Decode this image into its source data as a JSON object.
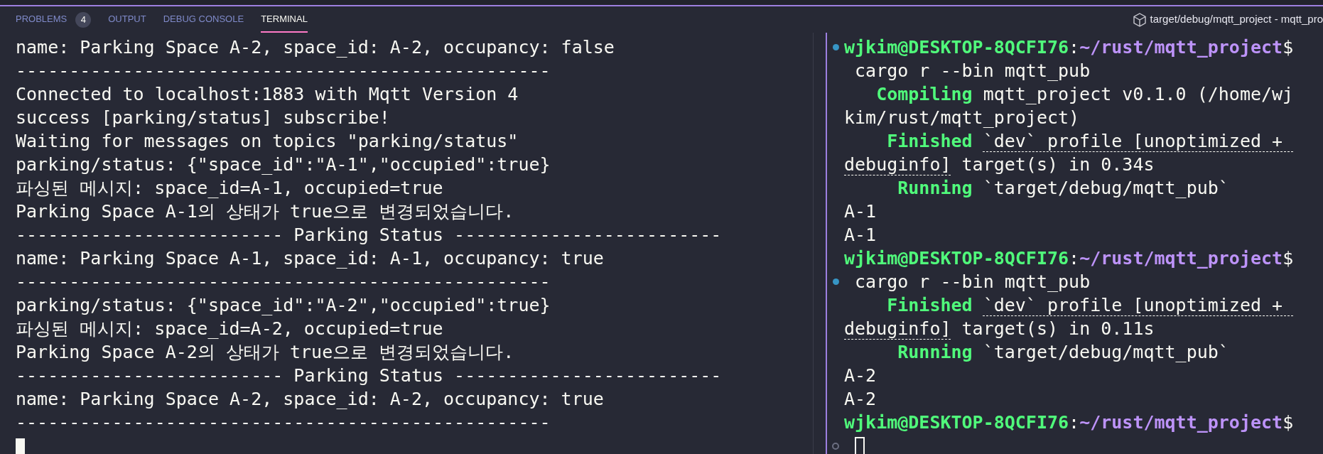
{
  "panel_tabs": [
    {
      "label": "PROBLEMS",
      "badge": "4",
      "selected": false
    },
    {
      "label": "OUTPUT",
      "selected": false
    },
    {
      "label": "DEBUG CONSOLE",
      "selected": false
    },
    {
      "label": "TERMINAL",
      "selected": true
    }
  ],
  "terminal_title": "target/debug/mqtt_project - mqtt_pro",
  "left_terminal": {
    "lines": [
      "name: Parking Space A-2, space_id: A-2, occupancy: false",
      "--------------------------------------------------",
      "Connected to localhost:1883 with Mqtt Version 4",
      "success [parking/status] subscribe!",
      "Waiting for messages on topics \"parking/status\"",
      "parking/status: {\"space_id\":\"A-1\",\"occupied\":true}",
      "파싱된 메시지: space_id=A-1, occupied=true",
      "Parking Space A-1의 상태가 true으로 변경되었습니다.",
      "------------------------- Parking Status -------------------------",
      "name: Parking Space A-1, space_id: A-1, occupancy: true",
      "--------------------------------------------------",
      "parking/status: {\"space_id\":\"A-2\",\"occupied\":true}",
      "파싱된 메시지: space_id=A-2, occupied=true",
      "Parking Space A-2의 상태가 true으로 변경되었습니다.",
      "------------------------- Parking Status -------------------------",
      "name: Parking Space A-2, space_id: A-2, occupancy: true",
      "--------------------------------------------------"
    ],
    "cursor": true
  },
  "right_terminal": {
    "lines": [
      {
        "command_mark": {
          "finished": true
        },
        "segments": [
          {
            "kind": "user",
            "text": "wjkim@DESKTOP-8QCFI76"
          },
          {
            "kind": "plain",
            "text": ":"
          },
          {
            "kind": "path",
            "text": "~/rust/mqtt_project"
          },
          {
            "kind": "plain",
            "text": "$"
          }
        ]
      },
      {
        "segments": [
          {
            "kind": "plain",
            "text": " cargo r --bin mqtt_pub"
          }
        ]
      },
      {
        "segments": [
          {
            "kind": "status",
            "text": "Compiling"
          },
          {
            "kind": "plain",
            "text": "mqtt_project v0.1.0 (/home/wj"
          }
        ]
      },
      {
        "segments": [
          {
            "kind": "plain",
            "text": "kim/rust/mqtt_project)"
          }
        ]
      },
      {
        "segments": [
          {
            "kind": "status",
            "text": "Finished"
          },
          {
            "kind": "link",
            "text": "`dev` profile [unoptimized + "
          }
        ]
      },
      {
        "segments": [
          {
            "kind": "link",
            "text": "debuginfo]"
          },
          {
            "kind": "plain",
            "text": " target(s) in 0.34s"
          }
        ]
      },
      {
        "segments": [
          {
            "kind": "status",
            "text": "Running"
          },
          {
            "kind": "plain",
            "text": "`target/debug/mqtt_pub`"
          }
        ]
      },
      {
        "segments": [
          {
            "kind": "plain",
            "text": "A-1"
          }
        ]
      },
      {
        "segments": [
          {
            "kind": "plain",
            "text": "A-1"
          }
        ]
      },
      {
        "segments": [
          {
            "kind": "user",
            "text": "wjkim@DESKTOP-8QCFI76"
          },
          {
            "kind": "plain",
            "text": ":"
          },
          {
            "kind": "path",
            "text": "~/rust/mqtt_project"
          },
          {
            "kind": "plain",
            "text": "$"
          }
        ]
      },
      {
        "command_mark": {
          "finished": true
        },
        "segments": [
          {
            "kind": "plain",
            "text": " cargo r --bin mqtt_pub"
          }
        ]
      },
      {
        "segments": [
          {
            "kind": "status",
            "text": "Finished"
          },
          {
            "kind": "link",
            "text": "`dev` profile [unoptimized + "
          }
        ]
      },
      {
        "segments": [
          {
            "kind": "link",
            "text": "debuginfo]"
          },
          {
            "kind": "plain",
            "text": " target(s) in 0.11s"
          }
        ]
      },
      {
        "segments": [
          {
            "kind": "status",
            "text": "Running"
          },
          {
            "kind": "plain",
            "text": "`target/debug/mqtt_pub`"
          }
        ]
      },
      {
        "segments": [
          {
            "kind": "plain",
            "text": "A-2"
          }
        ]
      },
      {
        "segments": [
          {
            "kind": "plain",
            "text": "A-2"
          }
        ]
      },
      {
        "segments": [
          {
            "kind": "user",
            "text": "wjkim@DESKTOP-8QCFI76"
          },
          {
            "kind": "plain",
            "text": ":"
          },
          {
            "kind": "path",
            "text": "~/rust/mqtt_project"
          },
          {
            "kind": "plain",
            "text": "$"
          }
        ]
      },
      {
        "command_mark": {
          "finished": false
        },
        "cursor": true
      }
    ]
  }
}
